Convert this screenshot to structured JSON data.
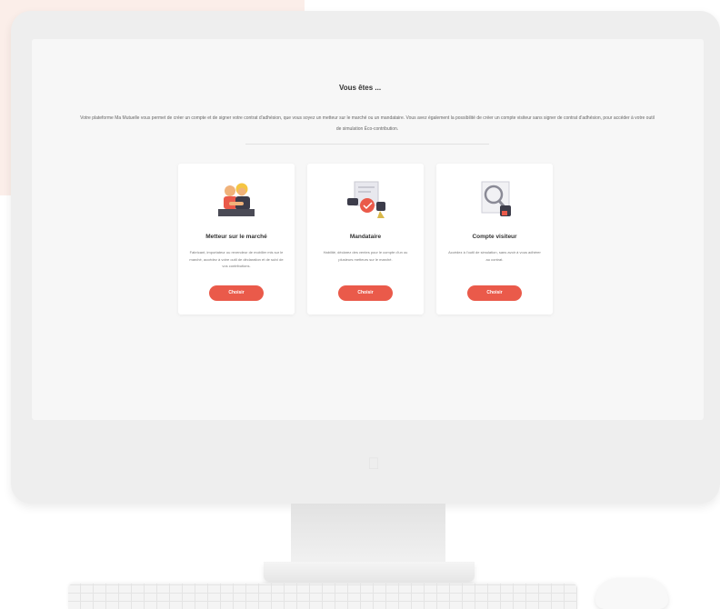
{
  "page": {
    "title": "Vous êtes ...",
    "intro": "Votre plateforme Ma Mutuelle vous permet de créer un compte et de signer votre contrat d'adhésion, que vous soyez un metteur sur le marché ou un mandataire. Vous avez également la possibilité de créer un compte visiteur sans signer de contrat d'adhésion, pour accéder à votre outil de simulation Éco-contribution."
  },
  "cards": [
    {
      "title": "Metteur sur le marché",
      "desc": "Fabricant, importateur ou revendeur de mobilier mis sur le marché, accédez à votre outil de déclaration et de suivi de vos contributions.",
      "button": "Choisir",
      "icon": "handshake-people-icon"
    },
    {
      "title": "Mandataire",
      "desc": "Habilité, déclarez des ventes pour le compte d'un ou plusieurs metteurs sur le marché.",
      "button": "Choisir",
      "icon": "handshake-contract-icon"
    },
    {
      "title": "Compte visiteur",
      "desc": "Accédez à l'outil de simulation, sans avoir à vous adhérer au contrat.",
      "button": "Choisir",
      "icon": "magnifier-document-icon"
    }
  ],
  "colors": {
    "accent": "#ea5a4a",
    "blush": "#fbeee9",
    "screen": "#f7f7f7"
  }
}
